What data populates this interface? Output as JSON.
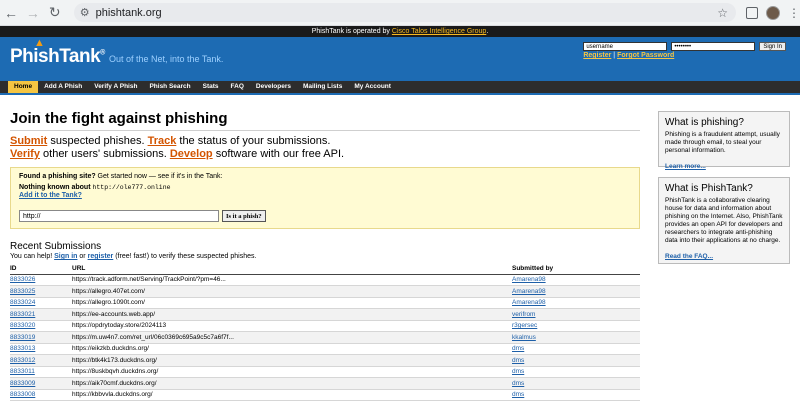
{
  "browser": {
    "url": "phishtank.org"
  },
  "operated": {
    "text": "PhishTank is operated by",
    "link": "Cisco Talos Intelligence Group",
    "suffix": "."
  },
  "header": {
    "logo": "PhishTank",
    "logo_mark": "®",
    "tagline": "Out of the Net, into the Tank.",
    "username_value": "username",
    "password_value": "••••••••",
    "signin_label": "Sign In",
    "register_label": "Register",
    "separator": "|",
    "forgot_label": "Forgot Password"
  },
  "nav": {
    "items": [
      "Home",
      "Add A Phish",
      "Verify A Phish",
      "Phish Search",
      "Stats",
      "FAQ",
      "Developers",
      "Mailing Lists",
      "My Account"
    ]
  },
  "main": {
    "title": "Join the fight against phishing",
    "lead": {
      "submit": "Submit",
      "submit_rest": " suspected phishes. ",
      "track": "Track",
      "track_rest": " the status of your submissions.",
      "verify": "Verify",
      "verify_rest": " other users' submissions. ",
      "develop": "Develop",
      "develop_rest": " software with our free API."
    },
    "find": {
      "question_bold": "Found a phishing site?",
      "question_rest": " Get started now — see if it's in the Tank:",
      "nothing_label": "Nothing known about ",
      "nothing_url": "http://ole777.online",
      "add_link": "Add it to the Tank?",
      "input_value": "http://",
      "button_label": "Is it a phish?"
    },
    "recent": {
      "title": "Recent Submissions",
      "help_prefix": "You can help! ",
      "signin": "Sign in",
      "or": " or ",
      "register": "register",
      "help_suffix": " (free! fast!) to verify these suspected phishes.",
      "headers": [
        "ID",
        "URL",
        "Submitted by"
      ],
      "rows": [
        {
          "id": "8833026",
          "url": "https://track.adform.net/Serving/TrackPoint/?pm=46...",
          "by": "Amarena98"
        },
        {
          "id": "8833025",
          "url": "https://allegro.407et.com/",
          "by": "Amarena98"
        },
        {
          "id": "8833024",
          "url": "https://allegro.1090t.com/",
          "by": "Amarena98"
        },
        {
          "id": "8833021",
          "url": "https://ee-accounts.web.app/",
          "by": "verifrom"
        },
        {
          "id": "8833020",
          "url": "https://opdrytoday.store/2024113",
          "by": "r3gersec"
        },
        {
          "id": "8833019",
          "url": "https://m.uw4n7.com/ret_url/06c0369c695a9c5c7a6f7f...",
          "by": "kkalmus"
        },
        {
          "id": "8833013",
          "url": "https://eikzkb.duckdns.org/",
          "by": "dms"
        },
        {
          "id": "8833012",
          "url": "https://btk4k173.duckdns.org/",
          "by": "dms"
        },
        {
          "id": "8833011",
          "url": "https://8uskbqvh.duckdns.org/",
          "by": "dms"
        },
        {
          "id": "8833009",
          "url": "https://aik70cmf.duckdns.org/",
          "by": "dms"
        },
        {
          "id": "8833008",
          "url": "https://kbbvvla.duckdns.org/",
          "by": "dms"
        }
      ]
    }
  },
  "sidebar": {
    "what_phishing": {
      "title": "What is phishing?",
      "body": "Phishing is a fraudulent attempt, usually made through email, to steal your personal information.",
      "link": "Learn more..."
    },
    "what_phishtank": {
      "title": "What is PhishTank?",
      "body": "PhishTank is a collaborative clearing house for data and information about phishing on the Internet. Also, PhishTank provides an open API for developers and researchers to integrate anti-phishing data into their applications at no charge.",
      "link": "Read the FAQ..."
    }
  },
  "colors": {
    "header_blue": "#1d6bb3",
    "accent_orange": "#d35400",
    "nav_active": "#f5c542",
    "link_blue": "#1d5fa8"
  }
}
